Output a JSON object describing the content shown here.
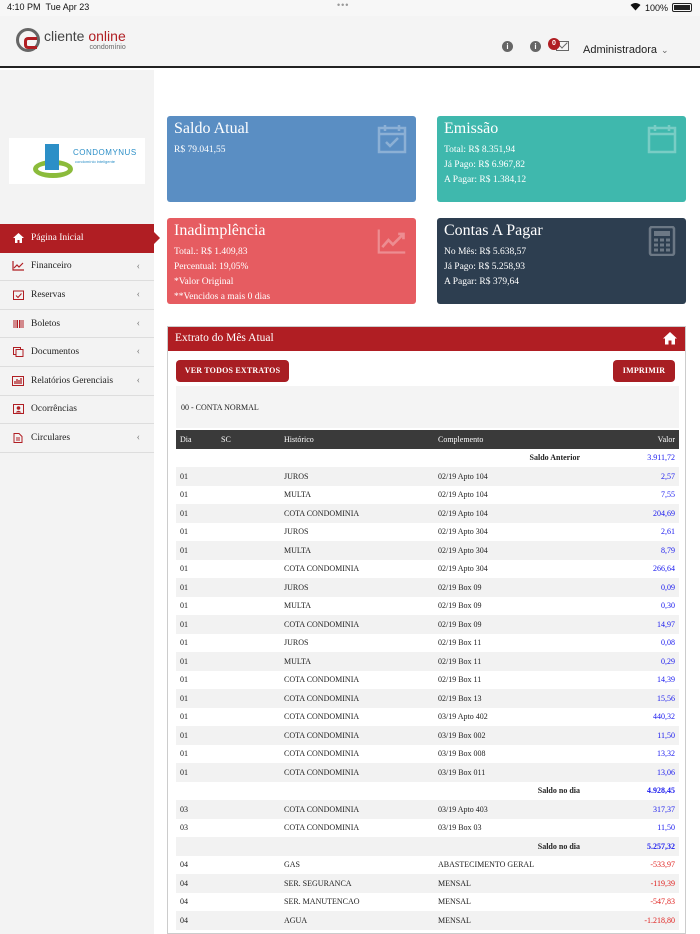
{
  "statusbar": {
    "time": "4:10 PM",
    "date": "Tue Apr 23",
    "battery": "100%"
  },
  "header": {
    "logo_main": "cliente",
    "logo_accent": "online",
    "logo_sub": "condomínio",
    "notifications_count": "0",
    "user": "Administradora"
  },
  "brand": {
    "name": "CONDOMYNUS",
    "tagline": "condomínio inteligente"
  },
  "menu": [
    {
      "label": "Página Inicial",
      "icon": "home-icon",
      "active": true
    },
    {
      "label": "Financeiro",
      "icon": "chart-icon"
    },
    {
      "label": "Reservas",
      "icon": "calendar-check-icon"
    },
    {
      "label": "Boletos",
      "icon": "barcode-icon"
    },
    {
      "label": "Documentos",
      "icon": "documents-icon"
    },
    {
      "label": "Relatórios Gerenciais",
      "icon": "bar-chart-icon"
    },
    {
      "label": "Ocorrências",
      "icon": "user-card-icon"
    },
    {
      "label": "Circulares",
      "icon": "file-icon"
    }
  ],
  "cards": {
    "saldo": {
      "title": "Saldo Atual",
      "lines": [
        "R$ 79.041,55"
      ]
    },
    "emissao": {
      "title": "Emissão",
      "lines": [
        "Total: R$ 8.351,94",
        "Já Pago: R$ 6.967,82",
        "A Pagar: R$ 1.384,12"
      ]
    },
    "inad": {
      "title": "Inadimplência",
      "lines": [
        "Total.: R$ 1.409,83",
        "Percentual: 19,05%",
        "*Valor Original",
        "**Vencidos a mais 0 dias"
      ]
    },
    "contas": {
      "title": "Contas A Pagar",
      "lines": [
        "No Mês: R$ 5.638,57",
        "Já Pago: R$ 5.258,93",
        "A Pagar: R$ 379,64"
      ]
    }
  },
  "extrato": {
    "title": "Extrato do Mês Atual",
    "btn_all": "VER TODOS EXTRATOS",
    "btn_print": "IMPRIMIR",
    "account": "00 - CONTA NORMAL",
    "columns": [
      "Dia",
      "SC",
      "Histórico",
      "Complemento",
      "Valor"
    ],
    "rows": [
      {
        "type": "sum",
        "label": "Saldo Anterior",
        "value": "3.911,72",
        "plain": true
      },
      {
        "dia": "01",
        "sc": "",
        "hist": "JUROS",
        "comp": "02/19 Apto 104",
        "val": "2,57"
      },
      {
        "dia": "01",
        "sc": "",
        "hist": "MULTA",
        "comp": "02/19 Apto 104",
        "val": "7,55"
      },
      {
        "dia": "01",
        "sc": "",
        "hist": "COTA CONDOMINIA",
        "comp": "02/19 Apto 104",
        "val": "204,69"
      },
      {
        "dia": "01",
        "sc": "",
        "hist": "JUROS",
        "comp": "02/19 Apto 304",
        "val": "2,61"
      },
      {
        "dia": "01",
        "sc": "",
        "hist": "MULTA",
        "comp": "02/19 Apto 304",
        "val": "8,79"
      },
      {
        "dia": "01",
        "sc": "",
        "hist": "COTA CONDOMINIA",
        "comp": "02/19 Apto 304",
        "val": "266,64"
      },
      {
        "dia": "01",
        "sc": "",
        "hist": "JUROS",
        "comp": "02/19 Box 09",
        "val": "0,09"
      },
      {
        "dia": "01",
        "sc": "",
        "hist": "MULTA",
        "comp": "02/19 Box 09",
        "val": "0,30"
      },
      {
        "dia": "01",
        "sc": "",
        "hist": "COTA CONDOMINIA",
        "comp": "02/19 Box 09",
        "val": "14,97"
      },
      {
        "dia": "01",
        "sc": "",
        "hist": "JUROS",
        "comp": "02/19 Box 11",
        "val": "0,08"
      },
      {
        "dia": "01",
        "sc": "",
        "hist": "MULTA",
        "comp": "02/19 Box 11",
        "val": "0,29"
      },
      {
        "dia": "01",
        "sc": "",
        "hist": "COTA CONDOMINIA",
        "comp": "02/19 Box 11",
        "val": "14,39"
      },
      {
        "dia": "01",
        "sc": "",
        "hist": "COTA CONDOMINIA",
        "comp": "02/19 Box 13",
        "val": "15,56"
      },
      {
        "dia": "01",
        "sc": "",
        "hist": "COTA CONDOMINIA",
        "comp": "03/19 Apto 402",
        "val": "440,32"
      },
      {
        "dia": "01",
        "sc": "",
        "hist": "COTA CONDOMINIA",
        "comp": "03/19 Box 002",
        "val": "11,50"
      },
      {
        "dia": "01",
        "sc": "",
        "hist": "COTA CONDOMINIA",
        "comp": "03/19 Box 008",
        "val": "13,32"
      },
      {
        "dia": "01",
        "sc": "",
        "hist": "COTA CONDOMINIA",
        "comp": "03/19 Box 011",
        "val": "13,06"
      },
      {
        "type": "sum",
        "label": "Saldo no dia",
        "value": "4.928,45"
      },
      {
        "dia": "03",
        "sc": "",
        "hist": "COTA CONDOMINIA",
        "comp": "03/19 Apto 403",
        "val": "317,37"
      },
      {
        "dia": "03",
        "sc": "",
        "hist": "COTA CONDOMINIA",
        "comp": "03/19 Box 03",
        "val": "11,50"
      },
      {
        "type": "sum",
        "label": "Saldo no dia",
        "value": "5.257,32"
      },
      {
        "dia": "04",
        "sc": "",
        "hist": "GAS",
        "comp": "ABASTECIMENTO GERAL",
        "val": "-533,97",
        "neg": true
      },
      {
        "dia": "04",
        "sc": "",
        "hist": "SER. SEGURANCA",
        "comp": "MENSAL",
        "val": "-119,39",
        "neg": true
      },
      {
        "dia": "04",
        "sc": "",
        "hist": "SER. MANUTENCAO",
        "comp": "MENSAL",
        "val": "-547,83",
        "neg": true
      },
      {
        "dia": "04",
        "sc": "",
        "hist": "AGUA",
        "comp": "MENSAL",
        "val": "-1.218,80",
        "neg": true
      }
    ]
  }
}
